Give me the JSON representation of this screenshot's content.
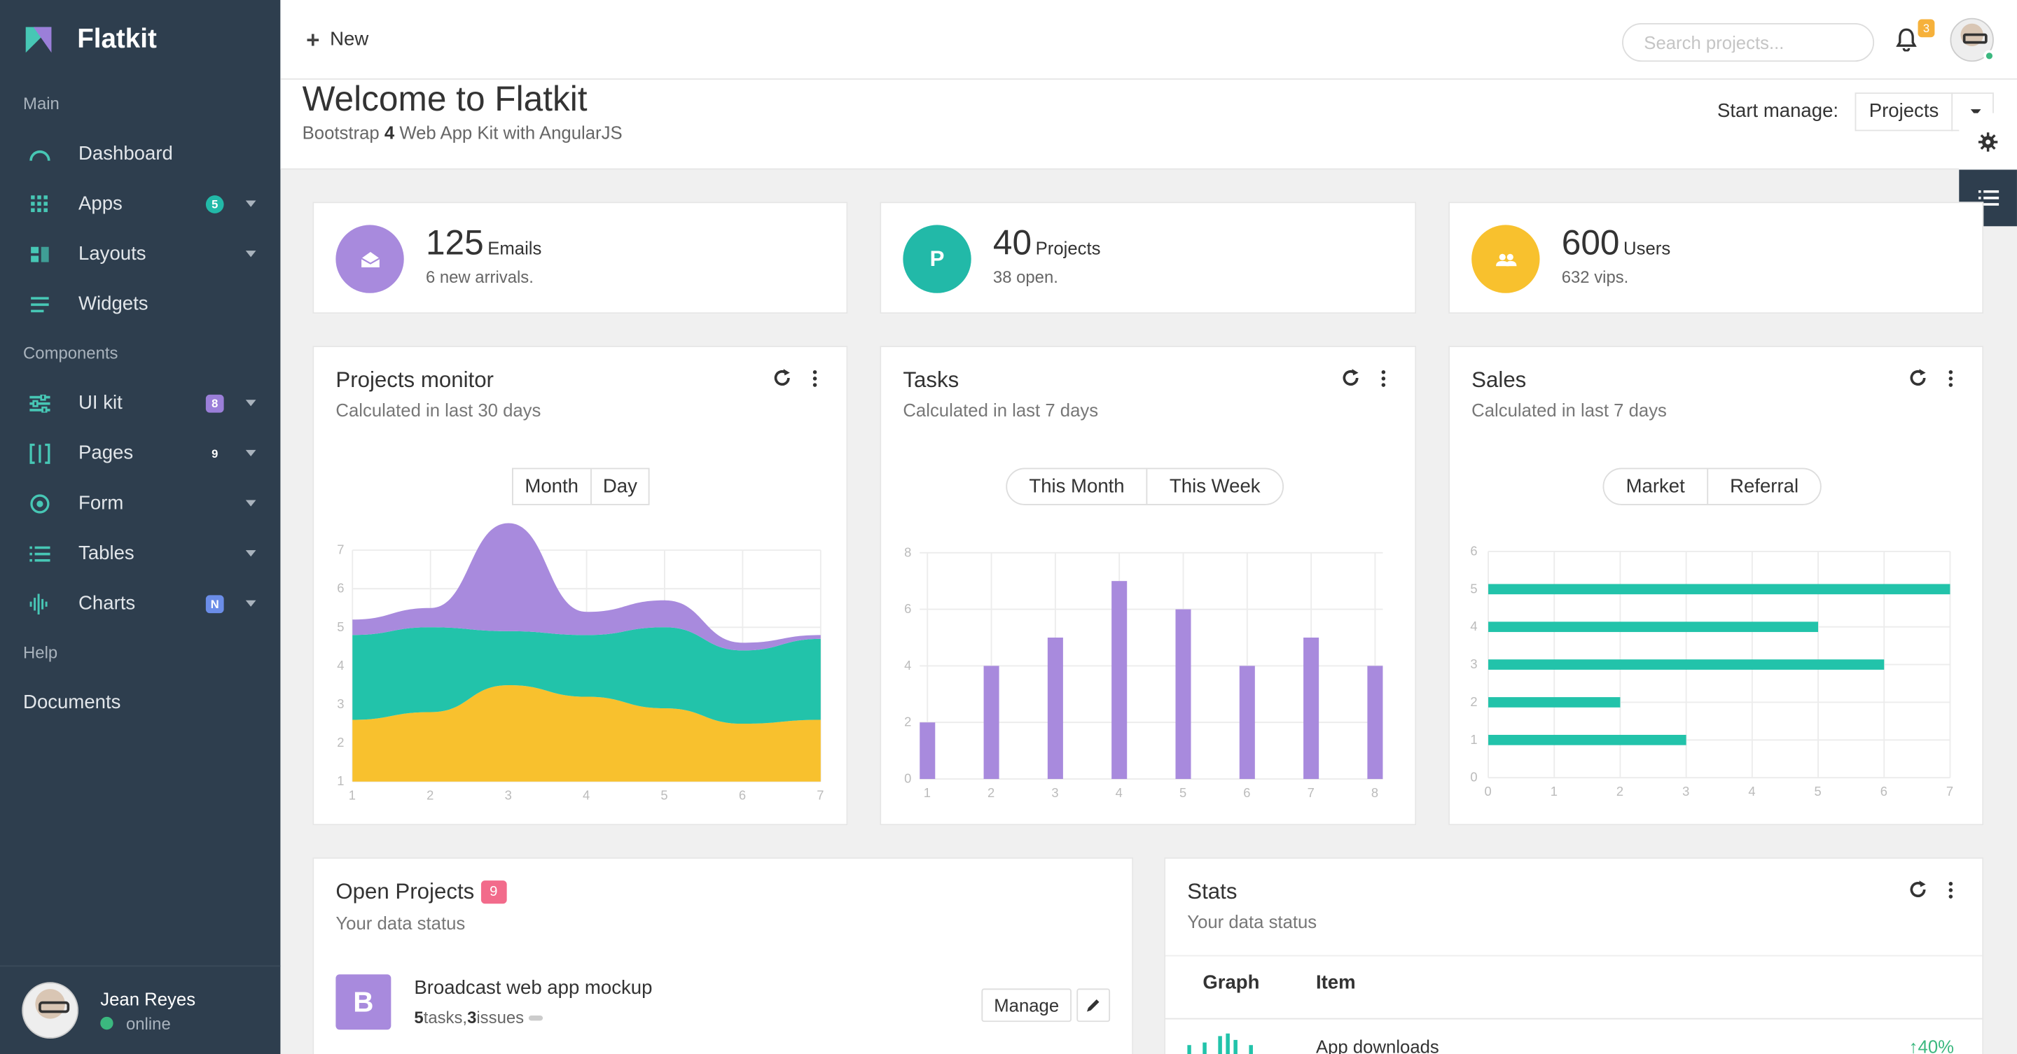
{
  "app": {
    "name": "Flatkit",
    "brand_color": "#2e3e4e",
    "accent_color": "#47c7b5"
  },
  "sidebar": {
    "sections": {
      "main": "Main",
      "components": "Components",
      "help": "Help"
    },
    "items": [
      {
        "label": "Dashboard",
        "icon": "dashboard-gauge-icon"
      },
      {
        "label": "Apps",
        "icon": "apps-grid-icon",
        "badge": "5",
        "badge_color": "#22b9a8"
      },
      {
        "label": "Layouts",
        "icon": "layouts-icon"
      },
      {
        "label": "Widgets",
        "icon": "widgets-icon"
      },
      {
        "label": "UI kit",
        "icon": "ui-kit-sliders-icon",
        "badge": "8",
        "badge_color": "#9b7fd9"
      },
      {
        "label": "Pages",
        "icon": "pages-icon",
        "badge": "9",
        "badge_color": "transparent"
      },
      {
        "label": "Form",
        "icon": "form-radio-icon"
      },
      {
        "label": "Tables",
        "icon": "tables-list-icon"
      },
      {
        "label": "Charts",
        "icon": "charts-wave-icon",
        "badge": "N",
        "badge_color": "#6b8de8"
      }
    ],
    "documents": "Documents",
    "user": {
      "name": "Jean Reyes",
      "status": "online"
    }
  },
  "topbar": {
    "new_label": "New",
    "search_placeholder": "Search projects...",
    "notifications_count": "3"
  },
  "header": {
    "title": "Welcome to Flatkit",
    "subtitle_prefix": "Bootstrap ",
    "subtitle_bold": "4",
    "subtitle_suffix": " Web App Kit with AngularJS",
    "start_manage_label": "Start manage:",
    "start_manage_value": "Projects"
  },
  "stats": [
    {
      "icon": "mail-icon",
      "value": "125",
      "unit": "Emails",
      "desc": "6 new arrivals.",
      "color": "#a88add"
    },
    {
      "icon": "letter-p-icon",
      "letter": "P",
      "value": "40",
      "unit": "Projects",
      "desc": "38 open.",
      "color": "#22b9a8"
    },
    {
      "icon": "users-icon",
      "value": "600",
      "unit": "Users",
      "desc": "632 vips.",
      "color": "#f8c12e"
    }
  ],
  "cards": {
    "projects_monitor": {
      "title": "Projects monitor",
      "subtitle": "Calculated in last 30 days",
      "tabs": [
        "Month",
        "Day"
      ]
    },
    "tasks": {
      "title": "Tasks",
      "subtitle": "Calculated in last 7 days",
      "tabs": [
        "This Month",
        "This Week"
      ]
    },
    "sales": {
      "title": "Sales",
      "subtitle": "Calculated in last 7 days",
      "tabs": [
        "Market",
        "Referral"
      ]
    },
    "open_projects": {
      "title": "Open Projects",
      "count": "9",
      "subtitle": "Your data status",
      "project": {
        "initial": "B",
        "name": "Broadcast web app mockup",
        "tasks": "5",
        "tasks_label": " tasks, ",
        "issues": "3",
        "issues_label": " issues"
      },
      "manage_label": "Manage"
    },
    "stats_table": {
      "title": "Stats",
      "subtitle": "Your data status",
      "columns": [
        "Graph",
        "Item"
      ],
      "rows": [
        {
          "item": "App downloads",
          "change": "40%"
        }
      ]
    }
  },
  "chart_data": [
    {
      "type": "area",
      "title": "Projects monitor",
      "x": [
        1,
        2,
        3,
        4,
        5,
        6,
        7
      ],
      "ylim": [
        1,
        7
      ],
      "series": [
        {
          "color": "#f8c12e",
          "values": [
            1.6,
            1.8,
            2.5,
            2.2,
            1.9,
            1.5,
            1.6
          ]
        },
        {
          "color": "#22c3aa",
          "values": [
            2.2,
            2.2,
            1.4,
            1.6,
            2.1,
            1.9,
            2.1
          ]
        },
        {
          "color": "#a88add",
          "values": [
            0.4,
            0.5,
            2.8,
            0.6,
            0.7,
            0.2,
            0.1
          ]
        }
      ],
      "stacked": true
    },
    {
      "type": "bar",
      "title": "Tasks",
      "categories": [
        1,
        2,
        3,
        4,
        5,
        6,
        7,
        8
      ],
      "values": [
        2,
        4,
        5,
        7,
        6,
        4,
        5,
        4
      ],
      "ylim": [
        0,
        8
      ],
      "color": "#a88add"
    },
    {
      "type": "bar",
      "orientation": "horizontal",
      "title": "Sales",
      "categories": [
        1,
        2,
        3,
        4,
        5
      ],
      "values": [
        3,
        2,
        6,
        5,
        7
      ],
      "xlim": [
        0,
        7
      ],
      "ylim": [
        0,
        6
      ],
      "color": "#22c3aa"
    }
  ]
}
